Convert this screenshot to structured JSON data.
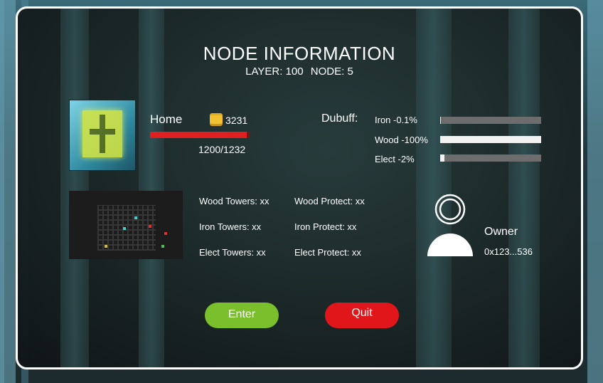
{
  "header": {
    "title": "NODE INFORMATION",
    "layer": "LAYER: 100",
    "node": "NODE: 5"
  },
  "home": {
    "label": "Home",
    "coins": "3231",
    "hp_text": "1200/1232",
    "hp_fraction": 0.974
  },
  "debuff": {
    "label": "Dubuff:",
    "items": [
      {
        "label": "Iron -0.1%",
        "fraction": 0.01
      },
      {
        "label": "Wood -100%",
        "fraction": 1.0
      },
      {
        "label": "Elect  -2%",
        "fraction": 0.04
      }
    ]
  },
  "towers": {
    "wood_towers": "Wood Towers: xx",
    "wood_protect": "Wood Protect: xx",
    "iron_towers": "Iron Towers: xx",
    "iron_protect": "Iron Protect: xx",
    "elect_towers": "Elect Towers: xx",
    "elect_protect": "Elect Protect: xx"
  },
  "owner": {
    "label": "Owner",
    "address": "0x123...536"
  },
  "buttons": {
    "enter": "Enter",
    "quit": "Quit"
  },
  "colors": {
    "enter": "#7ac02c",
    "quit": "#e0161b",
    "hp": "#e02020",
    "coin": "#f1c232"
  },
  "icons": [
    "coin-icon",
    "owner-avatar-icon",
    "node-thumbnail",
    "minimap"
  ]
}
